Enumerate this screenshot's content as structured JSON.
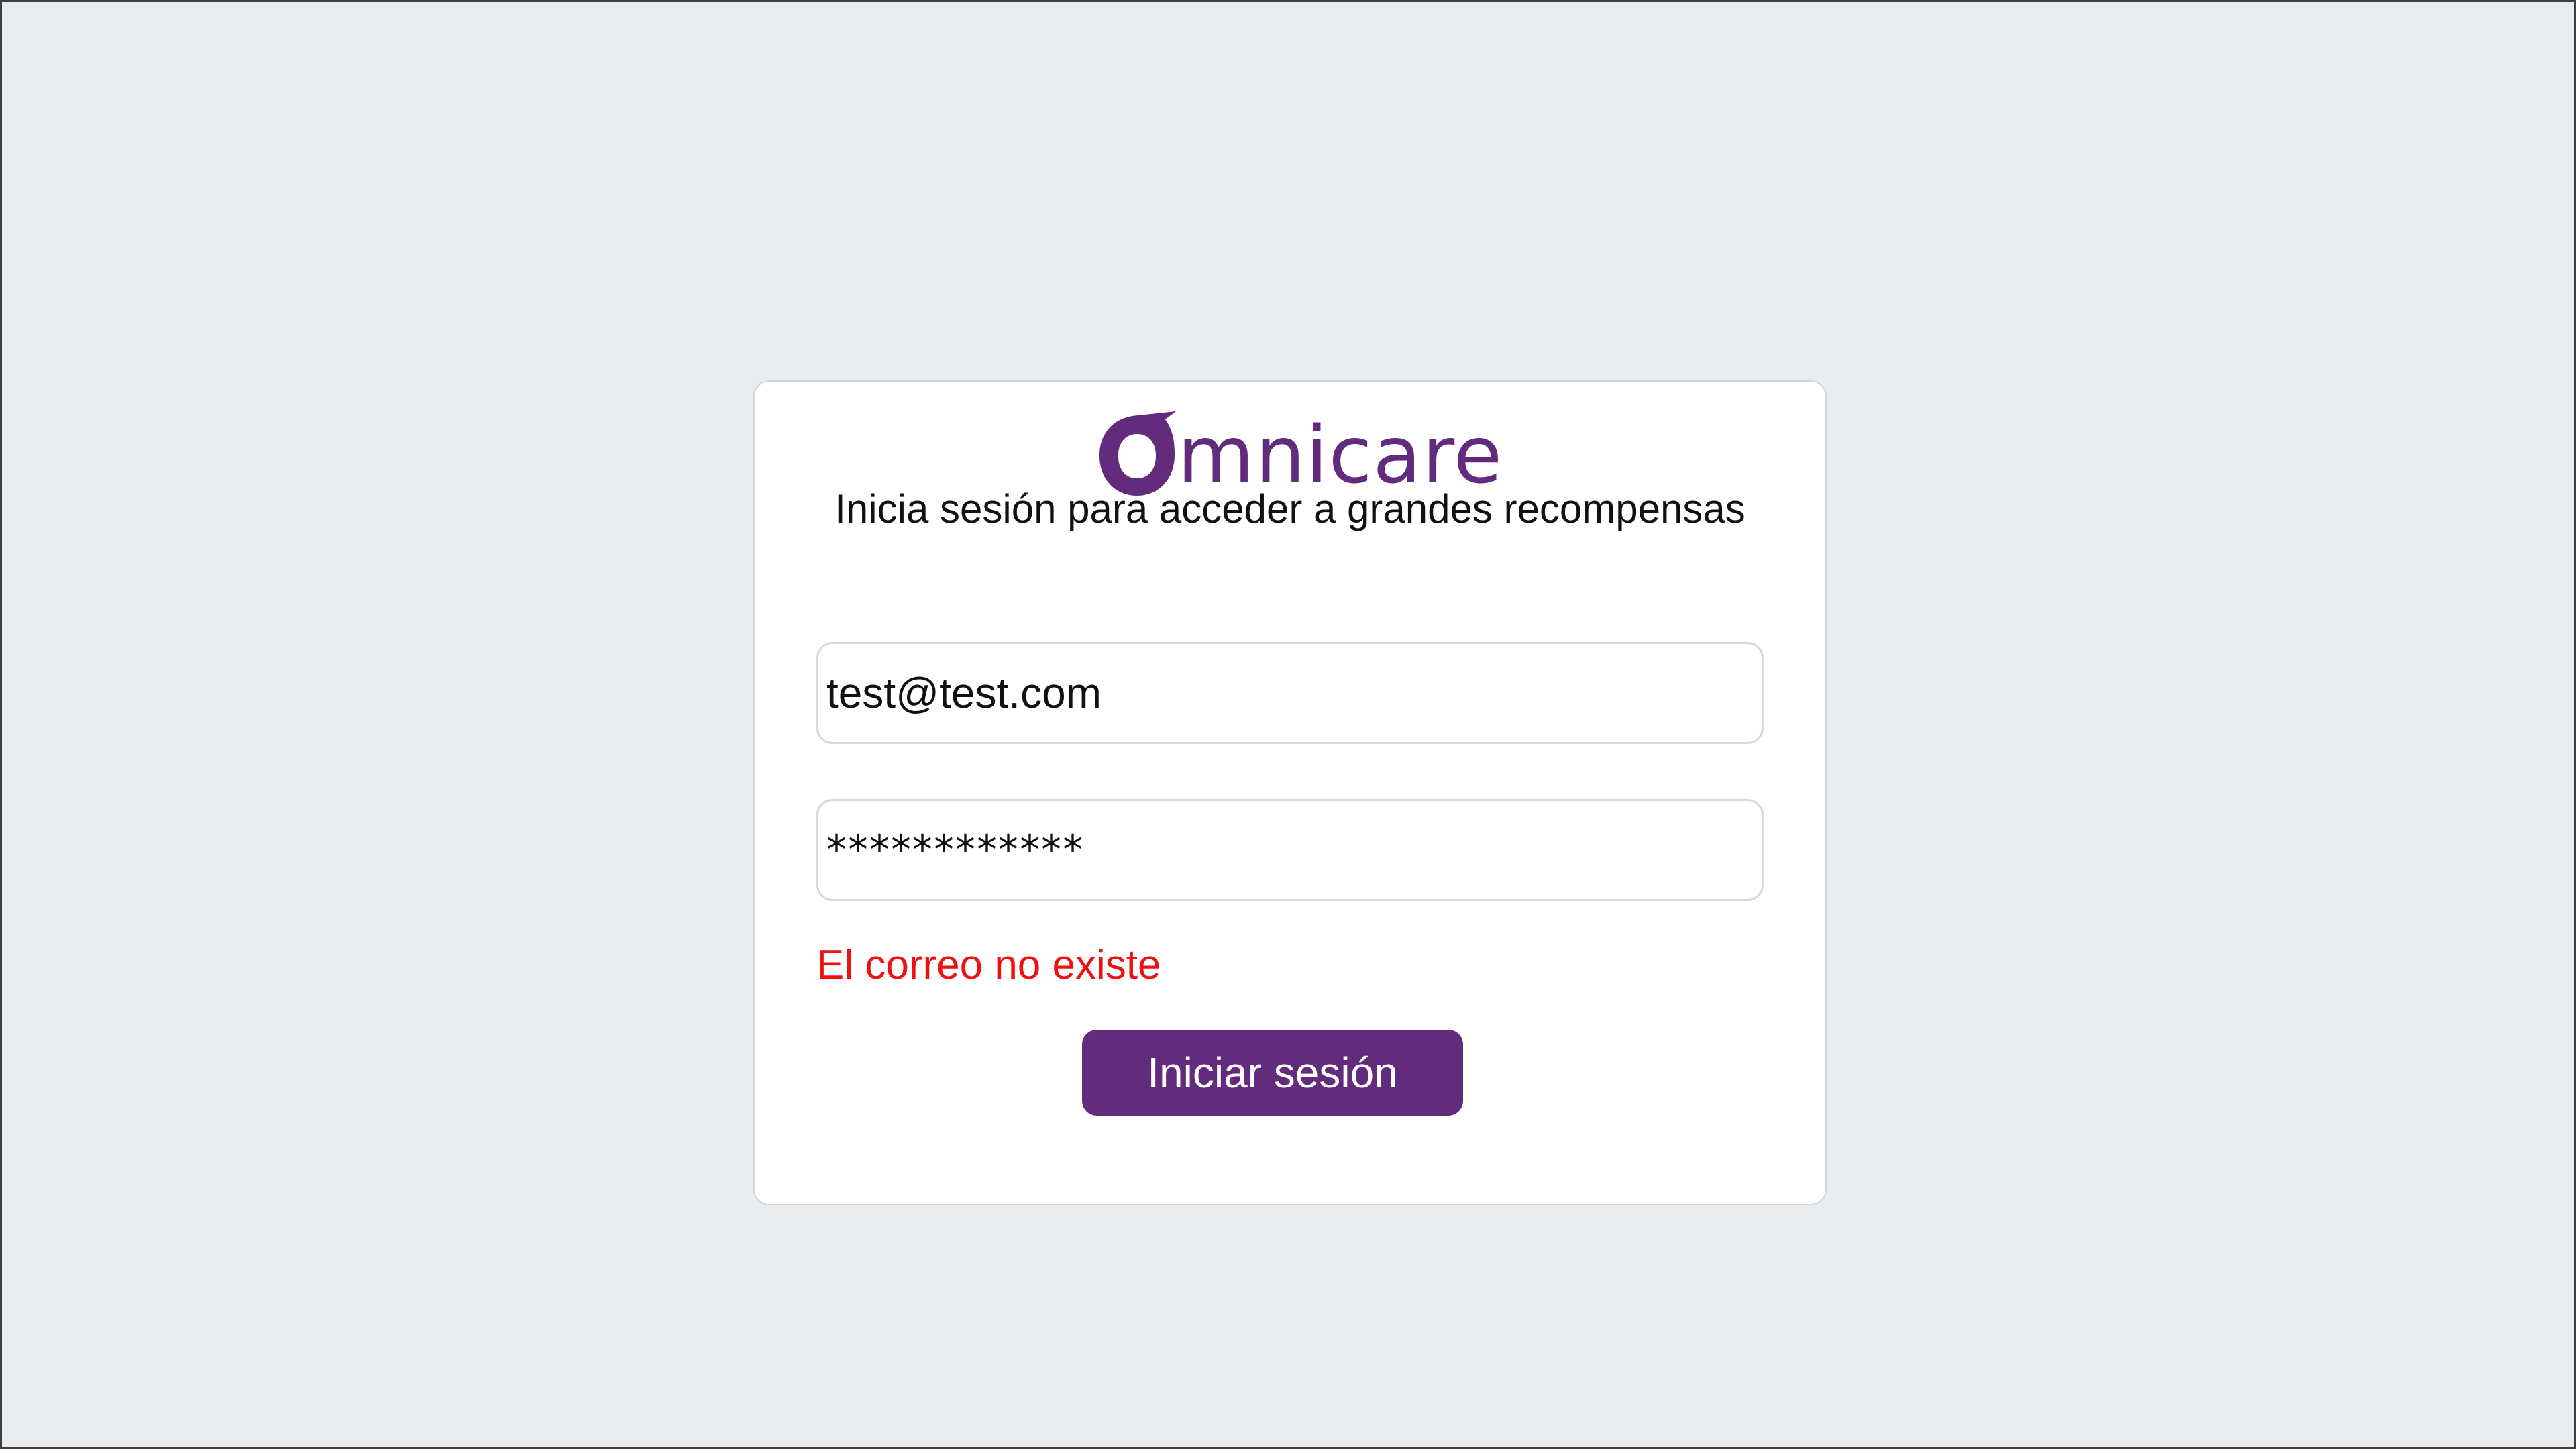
{
  "brand": {
    "logo_text": "mnicare",
    "logo_mark_icon": "omnicare-o-logo-icon",
    "color": "#632b7b"
  },
  "login": {
    "subtitle": "Inicia sesión para acceder a grandes recompensas",
    "email_value": "test@test.com",
    "password_mask": "************",
    "error_message": "El correo no existe",
    "submit_label": "Iniciar sesión"
  },
  "colors": {
    "background": "#e8ecee",
    "error": "#ee1111",
    "button": "#632b7b"
  }
}
